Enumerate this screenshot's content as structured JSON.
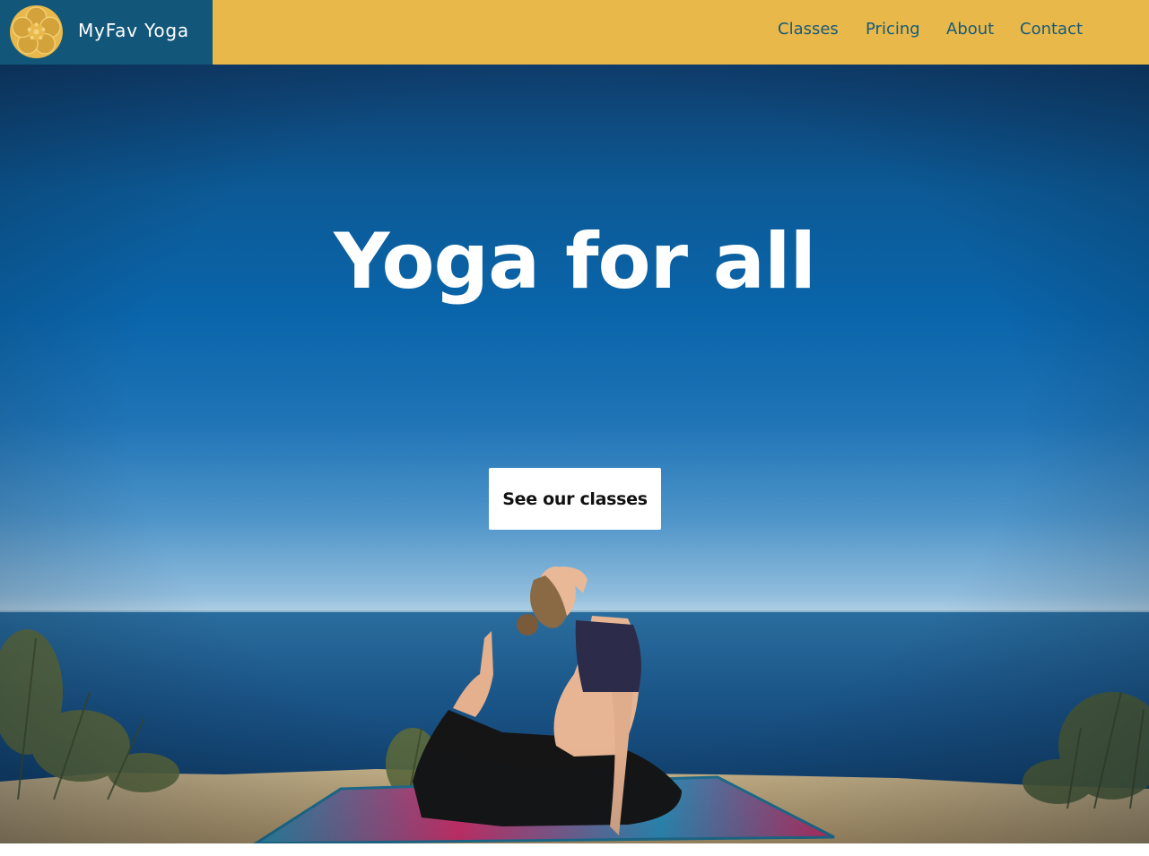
{
  "header": {
    "brand_name": "MyFav Yoga",
    "logo_icon": "flower-logo-icon",
    "nav": [
      {
        "label": "Classes"
      },
      {
        "label": "Pricing"
      },
      {
        "label": "About"
      },
      {
        "label": "Contact"
      }
    ]
  },
  "hero": {
    "title": "Yoga for all",
    "cta_label": "See our classes",
    "image": "woman-doing-yoga-pose-by-ocean"
  },
  "colors": {
    "nav_background": "#e8b84a",
    "brand_background": "#12577a",
    "nav_text": "#185a7a",
    "hero_title": "#ffffff",
    "cta_background": "#ffffff",
    "cta_text": "#111111"
  }
}
